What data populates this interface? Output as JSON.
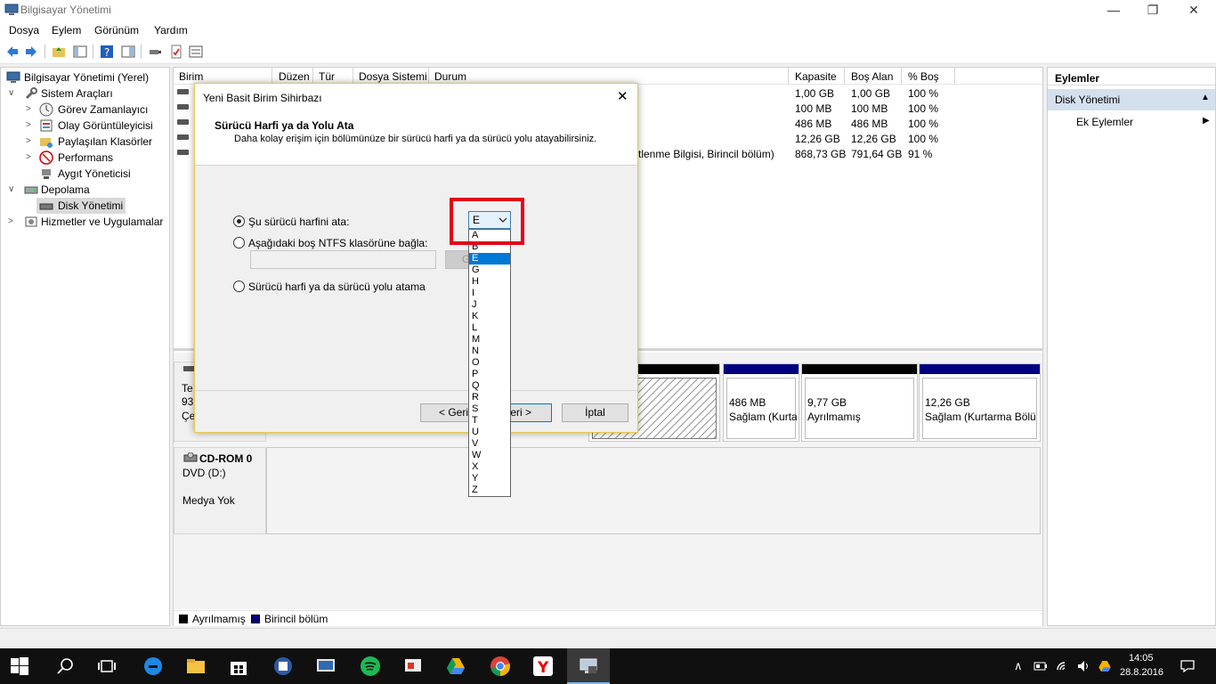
{
  "window": {
    "title": "Bilgisayar Yönetimi"
  },
  "menu": [
    "Dosya",
    "Eylem",
    "Görünüm",
    "Yardım"
  ],
  "tree": [
    {
      "label": "Bilgisayar Yönetimi (Yerel)"
    },
    {
      "label": "Sistem Araçları"
    },
    {
      "label": "Görev Zamanlayıcı"
    },
    {
      "label": "Olay Görüntüleyicisi"
    },
    {
      "label": "Paylaşılan Klasörler"
    },
    {
      "label": "Performans"
    },
    {
      "label": "Aygıt Yöneticisi"
    },
    {
      "label": "Depolama"
    },
    {
      "label": "Disk Yönetimi"
    },
    {
      "label": "Hizmetler ve Uygulamalar"
    }
  ],
  "volume_table": {
    "columns": [
      "Birim",
      "Düzen",
      "Tür",
      "Dosya Sistemi",
      "Durum",
      "Kapasite",
      "Boş Alan",
      "% Boş"
    ],
    "rows": [
      {
        "durum": "",
        "kapasite": "1,00 GB",
        "bos": "1,00 GB",
        "yuzde": "100 %"
      },
      {
        "durum": "",
        "kapasite": "100 MB",
        "bos": "100 MB",
        "yuzde": "100 %"
      },
      {
        "durum": "",
        "kapasite": "486 MB",
        "bos": "486 MB",
        "yuzde": "100 %"
      },
      {
        "durum": "",
        "kapasite": "12,26 GB",
        "bos": "12,26 GB",
        "yuzde": "100 %"
      },
      {
        "durum": "ilitlenme Bilgisi, Birincil bölüm)",
        "kapasite": "868,73 GB",
        "bos": "791,64 GB",
        "yuzde": "91 %"
      }
    ]
  },
  "disk0": {
    "label_line1": "Te",
    "label_line2": "93",
    "label_line3": "Çe"
  },
  "partitions": [
    {
      "line1": "",
      "line2": "ış"
    },
    {
      "line1": "486 MB",
      "line2": "Sağlam (Kurta"
    },
    {
      "line1": "9,77 GB",
      "line2": "Ayrılmamış"
    },
    {
      "line1": "12,26 GB",
      "line2": "Sağlam (Kurtarma Bölü"
    }
  ],
  "cdrom": {
    "name": "CD-ROM 0",
    "type": "DVD (D:)",
    "status": "Medya Yok"
  },
  "legend": {
    "unallocated": "Ayrılmamış",
    "primary": "Birincil bölüm",
    "unallocated_color": "#000000",
    "primary_color": "#000080"
  },
  "actions": {
    "title": "Eylemler",
    "section": "Disk Yönetimi",
    "more": "Ek Eylemler"
  },
  "dialog": {
    "title": "Yeni Basit Birim Sihirbazı",
    "heading": "Sürücü Harfi ya da Yolu Ata",
    "subheading": "Daha kolay erişim için bölümünüze bir sürücü harfi ya da sürücü yolu atayabilirsiniz.",
    "option_assign": "Şu sürücü harfini ata:",
    "option_mount": "Aşağıdaki boş NTFS klasörüne bağla:",
    "browse_label": "G",
    "option_none": "Sürücü harfi ya da sürücü yolu atama",
    "selected_letter": "E",
    "letters": [
      "A",
      "B",
      "E",
      "G",
      "H",
      "I",
      "J",
      "K",
      "L",
      "M",
      "N",
      "O",
      "P",
      "Q",
      "R",
      "S",
      "T",
      "U",
      "V",
      "W",
      "X",
      "Y",
      "Z"
    ],
    "back_button": "< Geri",
    "next_button": "eri >",
    "cancel_button": "İptal"
  },
  "taskbar": {
    "time": "14:05",
    "date": "28.8.2016"
  },
  "colors": {
    "highlight": "#e3001b",
    "selection": "#0078d7",
    "partition_bar": "#000080"
  }
}
